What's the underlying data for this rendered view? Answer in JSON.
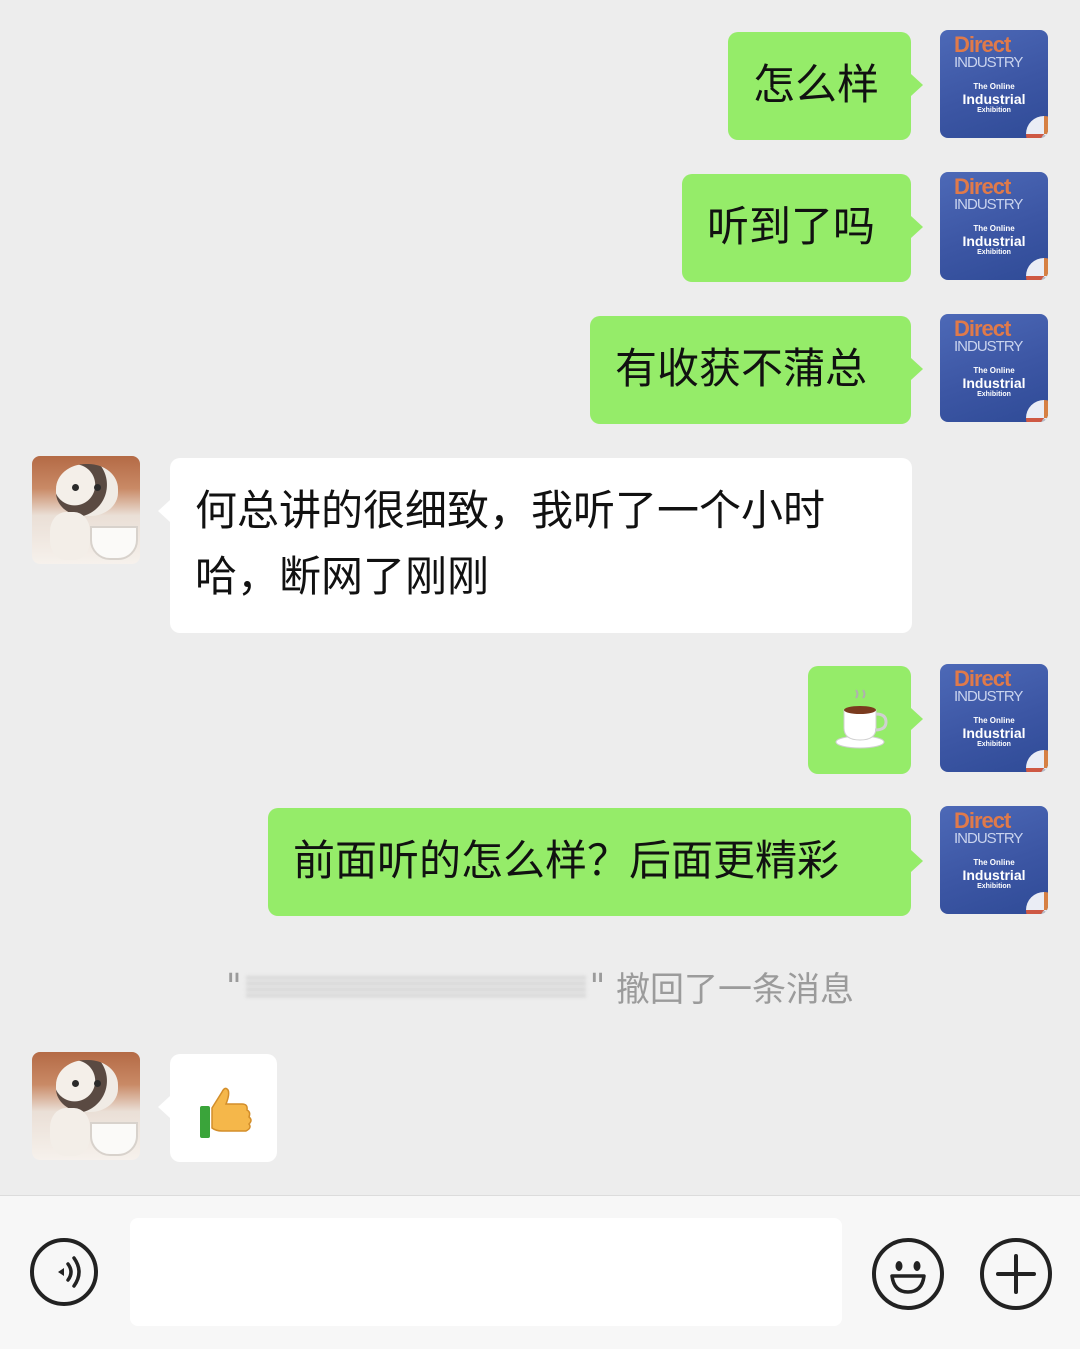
{
  "avatars": {
    "self": {
      "line1": "Direct",
      "line2": "INDUSTRY",
      "line3": "The Online",
      "line4": "Industrial",
      "line5": "Exhibition"
    },
    "other": {
      "icon": "cat-photo"
    }
  },
  "messages": [
    {
      "side": "right",
      "type": "text",
      "text": "怎么样"
    },
    {
      "side": "right",
      "type": "text",
      "text": "听到了吗"
    },
    {
      "side": "right",
      "type": "text",
      "text": "有收获不蒲总"
    },
    {
      "side": "left",
      "type": "text",
      "text": "何总讲的很细致，我听了一个小时哈，断网了刚刚"
    },
    {
      "side": "right",
      "type": "emoji",
      "icon": "coffee-cup-icon",
      "text": "☕"
    },
    {
      "side": "right",
      "type": "text",
      "text": "前面听的怎么样？后面更精彩"
    },
    {
      "side": "left",
      "type": "emoji",
      "icon": "thumbs-up-icon",
      "text": "👍"
    }
  ],
  "recall_notice": {
    "open_quote": "\"",
    "close_quote": "\"",
    "text": "撤回了一条消息"
  },
  "input_bar": {
    "voice_icon": "voice-icon",
    "emoji_icon": "smiley-icon",
    "plus_icon": "plus-icon",
    "placeholder": ""
  },
  "colors": {
    "background": "#ededed",
    "self_bubble": "#95ec69",
    "other_bubble": "#ffffff"
  }
}
